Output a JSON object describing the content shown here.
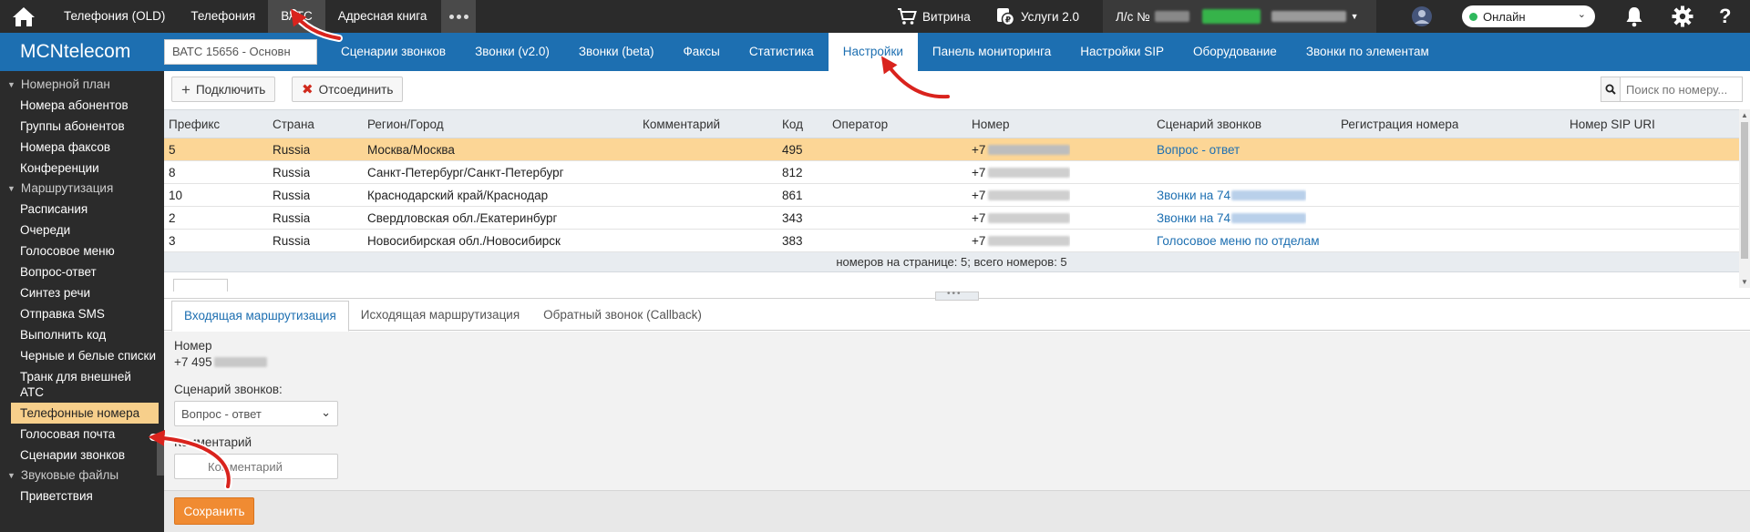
{
  "topnav": {
    "items": [
      "Телефония (OLD)",
      "Телефония",
      "ВАТС",
      "Адресная книга"
    ],
    "active": "ВАТС",
    "showcase": "Витрина",
    "services": "Услуги 2.0",
    "account_prefix": "Л/с №",
    "status": "Онлайн"
  },
  "header": {
    "logo": "MCNtelecom",
    "vatc_select": "ВАТС 15656 - Основн",
    "nav": [
      "Сценарии звонков",
      "Звонки (v2.0)",
      "Звонки (beta)",
      "Факсы",
      "Статистика",
      "Настройки",
      "Панель мониторинга",
      "Настройки SIP",
      "Оборудование",
      "Звонки по элементам"
    ],
    "active": "Настройки"
  },
  "sidebar": {
    "groups": [
      {
        "title": "Номерной план",
        "items": [
          "Номера абонентов",
          "Группы абонентов",
          "Номера факсов",
          "Конференции"
        ]
      },
      {
        "title": "Маршрутизация",
        "items": [
          "Расписания",
          "Очереди",
          "Голосовое меню",
          "Вопрос-ответ",
          "Синтез речи",
          "Отправка SMS",
          "Выполнить код",
          "Черные и белые списки",
          "Транк для внешней АТС",
          "Телефонные номера",
          "Голосовая почта",
          "Сценарии звонков"
        ]
      },
      {
        "title": "Звуковые файлы",
        "items": [
          "Приветствия"
        ]
      }
    ],
    "active_item": "Телефонные номера"
  },
  "toolbar": {
    "connect": "Подключить",
    "disconnect": "Отсоединить",
    "search_placeholder": "Поиск по номеру..."
  },
  "table": {
    "columns": [
      "Префикс",
      "Страна",
      "Регион/Город",
      "Комментарий",
      "Код",
      "Оператор",
      "Номер",
      "Сценарий звонков",
      "Регистрация номера",
      "Номер SIP URI"
    ],
    "rows": [
      {
        "prefix": "5",
        "country": "Russia",
        "region": "Москва/Москва",
        "comment": "",
        "code": "495",
        "operator": "",
        "number": "+7",
        "scenario": "Вопрос - ответ",
        "selected": true
      },
      {
        "prefix": "8",
        "country": "Russia",
        "region": "Санкт-Петербург/Санкт-Петербург",
        "comment": "",
        "code": "812",
        "operator": "",
        "number": "+7",
        "scenario": "",
        "selected": false
      },
      {
        "prefix": "10",
        "country": "Russia",
        "region": "Краснодарский край/Краснодар",
        "comment": "",
        "code": "861",
        "operator": "",
        "number": "+7",
        "scenario": "Звонки на 74",
        "selected": false
      },
      {
        "prefix": "2",
        "country": "Russia",
        "region": "Свердловская обл./Екатеринбург",
        "comment": "",
        "code": "343",
        "operator": "",
        "number": "+7",
        "scenario": "Звонки на 74",
        "selected": false
      },
      {
        "prefix": "3",
        "country": "Russia",
        "region": "Новосибирская обл./Новосибирск",
        "comment": "",
        "code": "383",
        "operator": "",
        "number": "+7",
        "scenario": "Голосовое меню по отделам",
        "selected": false
      }
    ],
    "footer": "номеров на странице: 5; всего номеров: 5"
  },
  "tabs": {
    "items": [
      "Входящая маршрутизация",
      "Исходящая маршрутизация",
      "Обратный звонок (Callback)"
    ],
    "active": "Входящая маршрутизация"
  },
  "form": {
    "number_label": "Номер",
    "number_value": "+7 495",
    "scenario_label": "Сценарий звонков:",
    "scenario_value": "Вопрос - ответ",
    "comment_label": "Комментарий",
    "comment_placeholder": "Комментарий",
    "save": "Сохранить"
  },
  "colors": {
    "topbar": "#2b2b2b",
    "header_blue": "#1d6fb1",
    "selected_row": "#fcd696",
    "active_sidebar": "#f7cf8b",
    "save_orange": "#f08b32",
    "annotation_arrow": "#d9231d"
  }
}
